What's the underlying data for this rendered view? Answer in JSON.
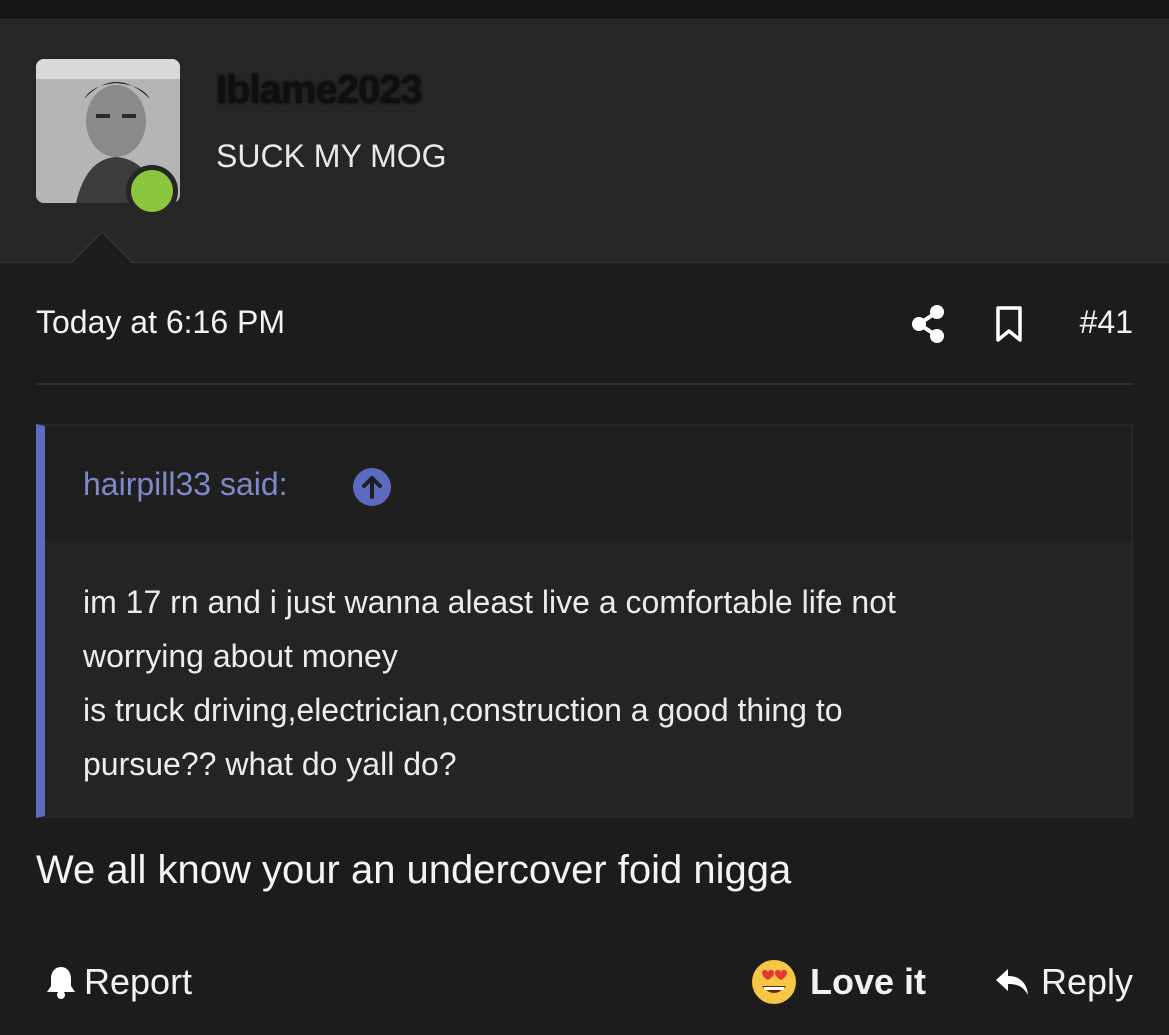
{
  "user": {
    "username": "Iblame2023",
    "title": "SUCK MY MOG",
    "avatar_icon": "user-photo",
    "online_color": "#8cc63e"
  },
  "post": {
    "date": "Today at 6:16 PM",
    "number": "#41",
    "share_icon": "share-icon",
    "bookmark_icon": "bookmark-icon"
  },
  "quote": {
    "author": "hairpill33 said:",
    "author_color": "#7f89c9",
    "bar_color": "#5c6bc0",
    "text": "im 17 rn and i just wanna aleast live a comfortable life not\nworrying about money\nis truck driving,electrician,construction a good thing to\npursue?? what do yall do?"
  },
  "reply": {
    "text": "We all know your an undercover foid nigga"
  },
  "footer": {
    "report_label": "Report",
    "love_label": "Love it",
    "reply_label": "Reply"
  }
}
